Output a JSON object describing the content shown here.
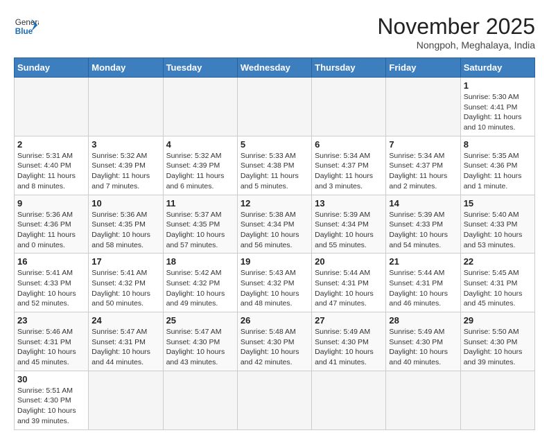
{
  "logo": {
    "general": "General",
    "blue": "Blue"
  },
  "title": "November 2025",
  "subtitle": "Nongpoh, Meghalaya, India",
  "weekdays": [
    "Sunday",
    "Monday",
    "Tuesday",
    "Wednesday",
    "Thursday",
    "Friday",
    "Saturday"
  ],
  "days": {
    "1": {
      "sunrise": "5:30 AM",
      "sunset": "4:41 PM",
      "daylight": "11 hours and 10 minutes."
    },
    "2": {
      "sunrise": "5:31 AM",
      "sunset": "4:40 PM",
      "daylight": "11 hours and 8 minutes."
    },
    "3": {
      "sunrise": "5:32 AM",
      "sunset": "4:39 PM",
      "daylight": "11 hours and 7 minutes."
    },
    "4": {
      "sunrise": "5:32 AM",
      "sunset": "4:39 PM",
      "daylight": "11 hours and 6 minutes."
    },
    "5": {
      "sunrise": "5:33 AM",
      "sunset": "4:38 PM",
      "daylight": "11 hours and 5 minutes."
    },
    "6": {
      "sunrise": "5:34 AM",
      "sunset": "4:37 PM",
      "daylight": "11 hours and 3 minutes."
    },
    "7": {
      "sunrise": "5:34 AM",
      "sunset": "4:37 PM",
      "daylight": "11 hours and 2 minutes."
    },
    "8": {
      "sunrise": "5:35 AM",
      "sunset": "4:36 PM",
      "daylight": "11 hours and 1 minute."
    },
    "9": {
      "sunrise": "5:36 AM",
      "sunset": "4:36 PM",
      "daylight": "11 hours and 0 minutes."
    },
    "10": {
      "sunrise": "5:36 AM",
      "sunset": "4:35 PM",
      "daylight": "10 hours and 58 minutes."
    },
    "11": {
      "sunrise": "5:37 AM",
      "sunset": "4:35 PM",
      "daylight": "10 hours and 57 minutes."
    },
    "12": {
      "sunrise": "5:38 AM",
      "sunset": "4:34 PM",
      "daylight": "10 hours and 56 minutes."
    },
    "13": {
      "sunrise": "5:39 AM",
      "sunset": "4:34 PM",
      "daylight": "10 hours and 55 minutes."
    },
    "14": {
      "sunrise": "5:39 AM",
      "sunset": "4:33 PM",
      "daylight": "10 hours and 54 minutes."
    },
    "15": {
      "sunrise": "5:40 AM",
      "sunset": "4:33 PM",
      "daylight": "10 hours and 53 minutes."
    },
    "16": {
      "sunrise": "5:41 AM",
      "sunset": "4:33 PM",
      "daylight": "10 hours and 52 minutes."
    },
    "17": {
      "sunrise": "5:41 AM",
      "sunset": "4:32 PM",
      "daylight": "10 hours and 50 minutes."
    },
    "18": {
      "sunrise": "5:42 AM",
      "sunset": "4:32 PM",
      "daylight": "10 hours and 49 minutes."
    },
    "19": {
      "sunrise": "5:43 AM",
      "sunset": "4:32 PM",
      "daylight": "10 hours and 48 minutes."
    },
    "20": {
      "sunrise": "5:44 AM",
      "sunset": "4:31 PM",
      "daylight": "10 hours and 47 minutes."
    },
    "21": {
      "sunrise": "5:44 AM",
      "sunset": "4:31 PM",
      "daylight": "10 hours and 46 minutes."
    },
    "22": {
      "sunrise": "5:45 AM",
      "sunset": "4:31 PM",
      "daylight": "10 hours and 45 minutes."
    },
    "23": {
      "sunrise": "5:46 AM",
      "sunset": "4:31 PM",
      "daylight": "10 hours and 45 minutes."
    },
    "24": {
      "sunrise": "5:47 AM",
      "sunset": "4:31 PM",
      "daylight": "10 hours and 44 minutes."
    },
    "25": {
      "sunrise": "5:47 AM",
      "sunset": "4:30 PM",
      "daylight": "10 hours and 43 minutes."
    },
    "26": {
      "sunrise": "5:48 AM",
      "sunset": "4:30 PM",
      "daylight": "10 hours and 42 minutes."
    },
    "27": {
      "sunrise": "5:49 AM",
      "sunset": "4:30 PM",
      "daylight": "10 hours and 41 minutes."
    },
    "28": {
      "sunrise": "5:49 AM",
      "sunset": "4:30 PM",
      "daylight": "10 hours and 40 minutes."
    },
    "29": {
      "sunrise": "5:50 AM",
      "sunset": "4:30 PM",
      "daylight": "10 hours and 39 minutes."
    },
    "30": {
      "sunrise": "5:51 AM",
      "sunset": "4:30 PM",
      "daylight": "10 hours and 39 minutes."
    }
  },
  "labels": {
    "sunrise": "Sunrise:",
    "sunset": "Sunset:",
    "daylight": "Daylight:"
  }
}
